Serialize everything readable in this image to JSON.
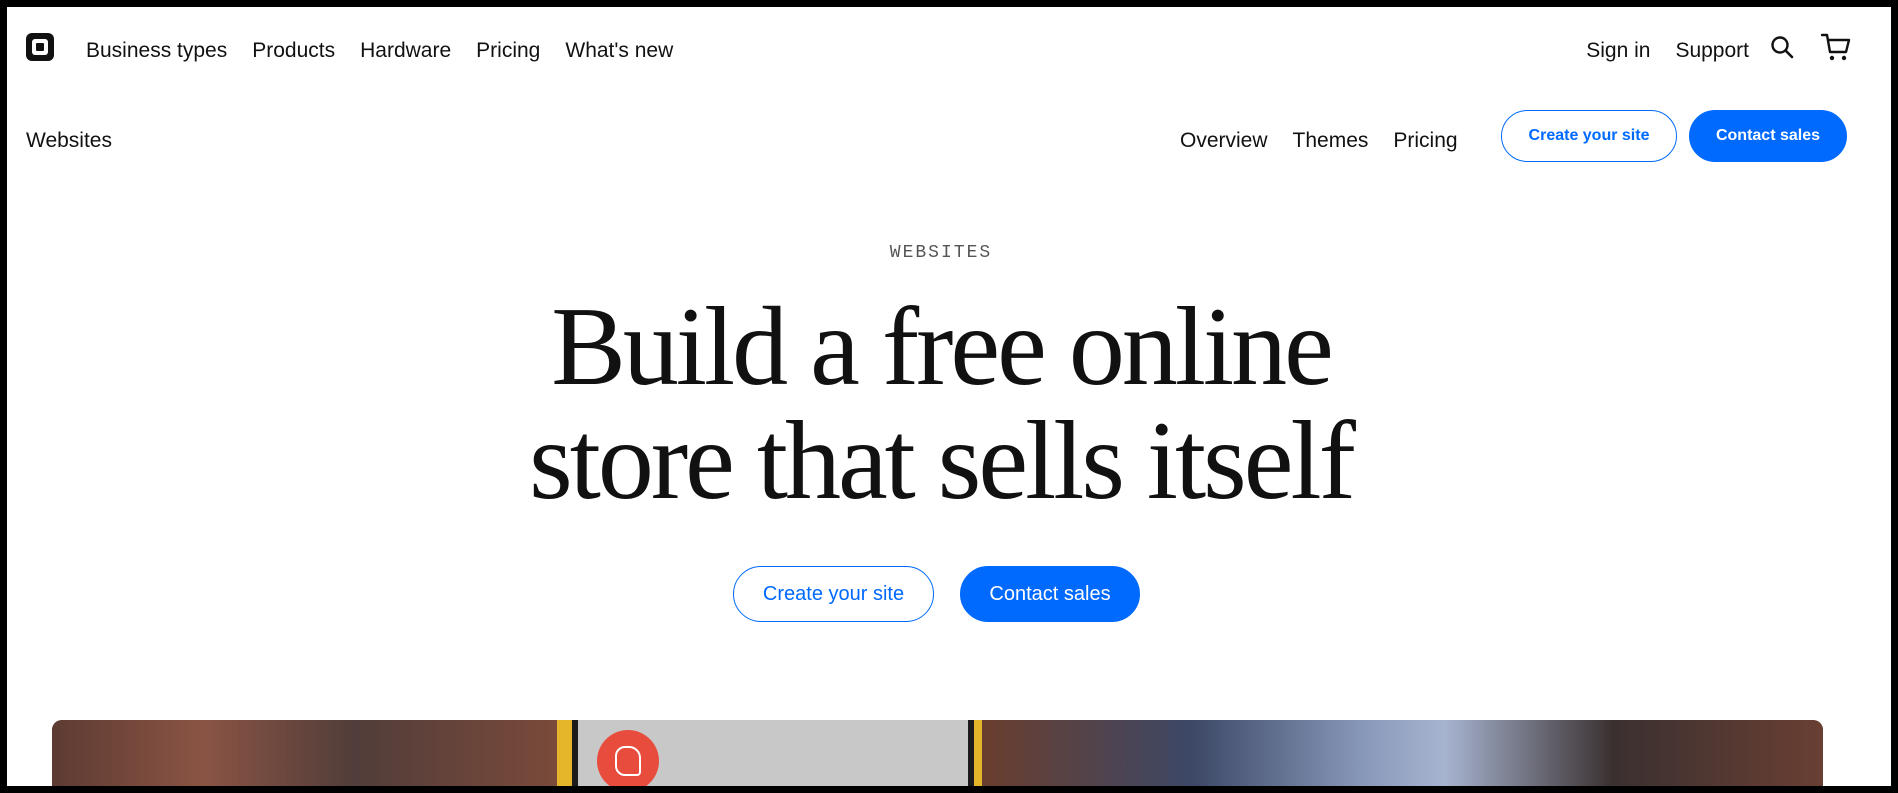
{
  "topnav": {
    "left_links": [
      "Business types",
      "Products",
      "Hardware",
      "Pricing",
      "What's new"
    ],
    "right_links": [
      "Sign in",
      "Support"
    ],
    "icons": [
      "logo-icon",
      "search-icon",
      "cart-icon"
    ]
  },
  "subnav": {
    "title": "Websites",
    "links": [
      "Overview",
      "Themes",
      "Pricing"
    ],
    "create_label": "Create your site",
    "contact_label": "Contact sales"
  },
  "hero": {
    "eyebrow": "WEBSITES",
    "headline_line1": "Build a free online",
    "headline_line2": "store that sells itself",
    "create_label": "Create your site",
    "contact_label": "Contact sales"
  },
  "colors": {
    "accent": "#006aff",
    "text": "#111111",
    "background": "#ffffff"
  }
}
